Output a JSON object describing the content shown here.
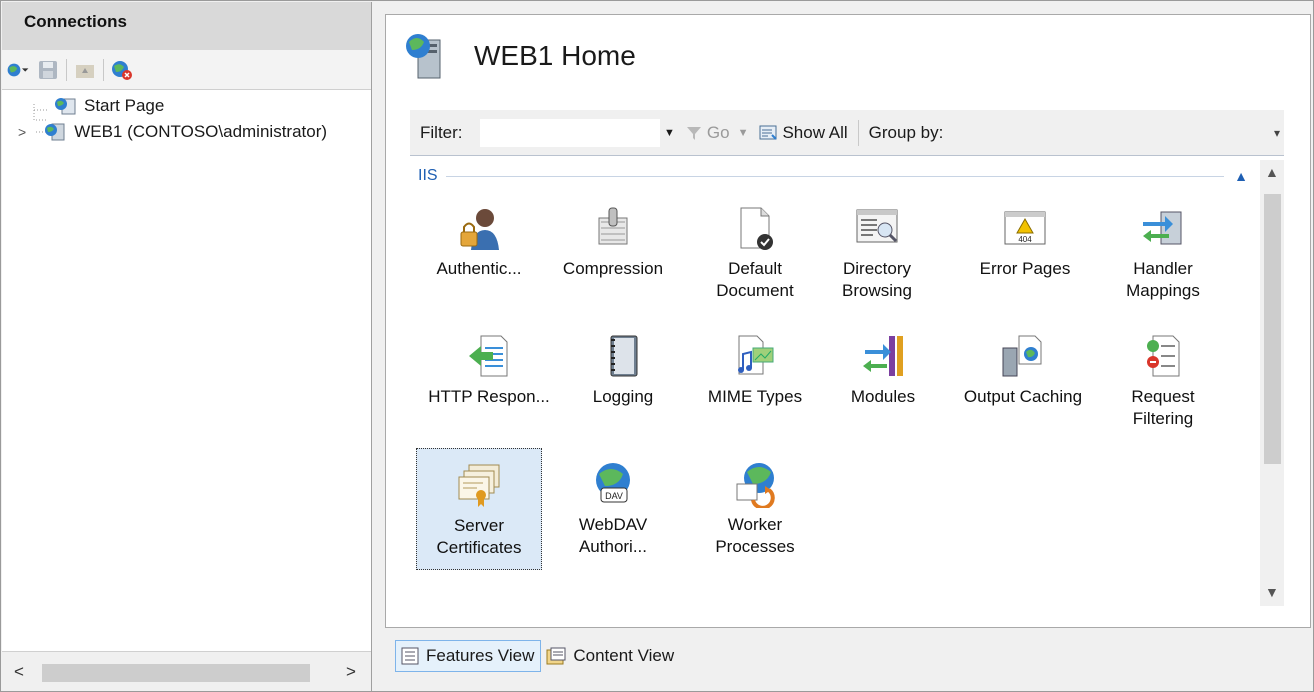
{
  "connections": {
    "title": "Connections",
    "tree": [
      {
        "label": "Start Page"
      },
      {
        "label": "WEB1 (CONTOSO\\administrator)"
      }
    ],
    "hscroll_left": "<",
    "hscroll_right": ">"
  },
  "home": {
    "title": "WEB1 Home",
    "filter": {
      "label": "Filter:",
      "value": "",
      "go_label": "Go",
      "show_all_label": "Show All",
      "group_by_label": "Group by:"
    },
    "group": {
      "name": "IIS"
    },
    "features": [
      {
        "label": "Authentic...",
        "icon": "authentication-icon"
      },
      {
        "label": "Compression",
        "icon": "compression-icon"
      },
      {
        "label": "Default Document",
        "icon": "default-document-icon"
      },
      {
        "label": "Directory Browsing",
        "icon": "directory-browsing-icon"
      },
      {
        "label": "Error Pages",
        "icon": "error-pages-icon",
        "badge": "404"
      },
      {
        "label": "Handler Mappings",
        "icon": "handler-mappings-icon"
      },
      {
        "label": "HTTP Respon...",
        "icon": "http-response-headers-icon"
      },
      {
        "label": "Logging",
        "icon": "logging-icon"
      },
      {
        "label": "MIME Types",
        "icon": "mime-types-icon"
      },
      {
        "label": "Modules",
        "icon": "modules-icon"
      },
      {
        "label": "Output Caching",
        "icon": "output-caching-icon"
      },
      {
        "label": "Request Filtering",
        "icon": "request-filtering-icon"
      },
      {
        "label": "Server Certificates",
        "icon": "server-certificates-icon",
        "selected": true
      },
      {
        "label": "WebDAV Authori...",
        "icon": "webdav-icon",
        "badge": "DAV"
      },
      {
        "label": "Worker Processes",
        "icon": "worker-processes-icon"
      }
    ]
  },
  "view_tabs": {
    "features_view": "Features View",
    "content_view": "Content View"
  },
  "colors": {
    "accent": "#1e5fb3",
    "selected_bg": "#dbe9f7",
    "header_bg": "#d9d9d9"
  }
}
